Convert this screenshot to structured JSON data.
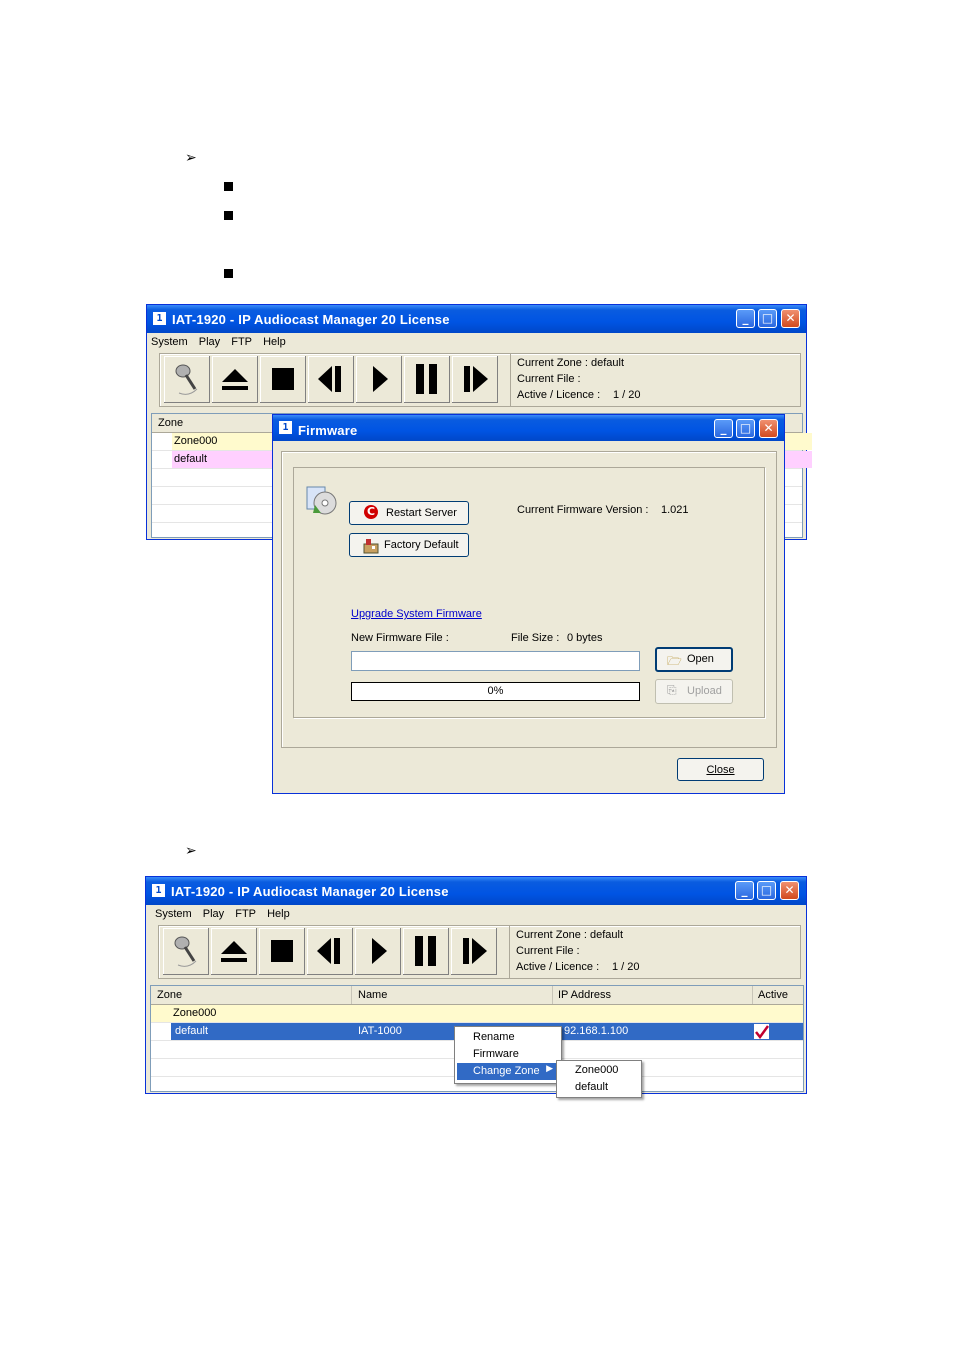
{
  "app": {
    "title": "IAT-1920 - IP Audiocast Manager 20 License",
    "menu": [
      "System",
      "Play",
      "FTP",
      "Help"
    ],
    "status": {
      "current_zone": "Current Zone :  default",
      "current_file": "Current File :",
      "active_licence_label": "Active / Licence :",
      "active_licence_value": "1 /    20"
    },
    "columns": [
      "Zone",
      "Name",
      "IP Address",
      "Active"
    ]
  },
  "window1": {
    "rows": [
      {
        "zone": "Zone000",
        "highlight": "#fffacd"
      },
      {
        "zone": "default",
        "highlight": "#ffd0ff"
      }
    ]
  },
  "firmware_dialog": {
    "title": "Firmware",
    "restart_server": "Restart Server",
    "factory_default": "Factory Default",
    "current_version_label": "Current Firmware Version :",
    "current_version_value": "1.021",
    "upgrade_link": "Upgrade System Firmware",
    "new_file_label": "New Firmware File :",
    "file_size_label": "File Size :",
    "file_size_value": "0 bytes",
    "file_path_value": "",
    "open": "Open",
    "upload": "Upload",
    "progress": "0%",
    "progress_value": 0,
    "close": "Close"
  },
  "window2": {
    "rows": [
      {
        "zone": "Zone000",
        "name": "",
        "ip": "",
        "active": false
      },
      {
        "zone": "default",
        "name": "IAT-1000",
        "ip": "92.168.1.100",
        "active": true
      }
    ],
    "context_menu": [
      "Rename",
      "Firmware",
      "Change Zone"
    ],
    "submenu": [
      "Zone000",
      "default"
    ]
  },
  "colors": {
    "title_blue": "#0054e3",
    "selection": "#316ac5",
    "zone000_row": "#fffacd",
    "default_row": "#ffd0ff",
    "link": "#0000cc"
  }
}
